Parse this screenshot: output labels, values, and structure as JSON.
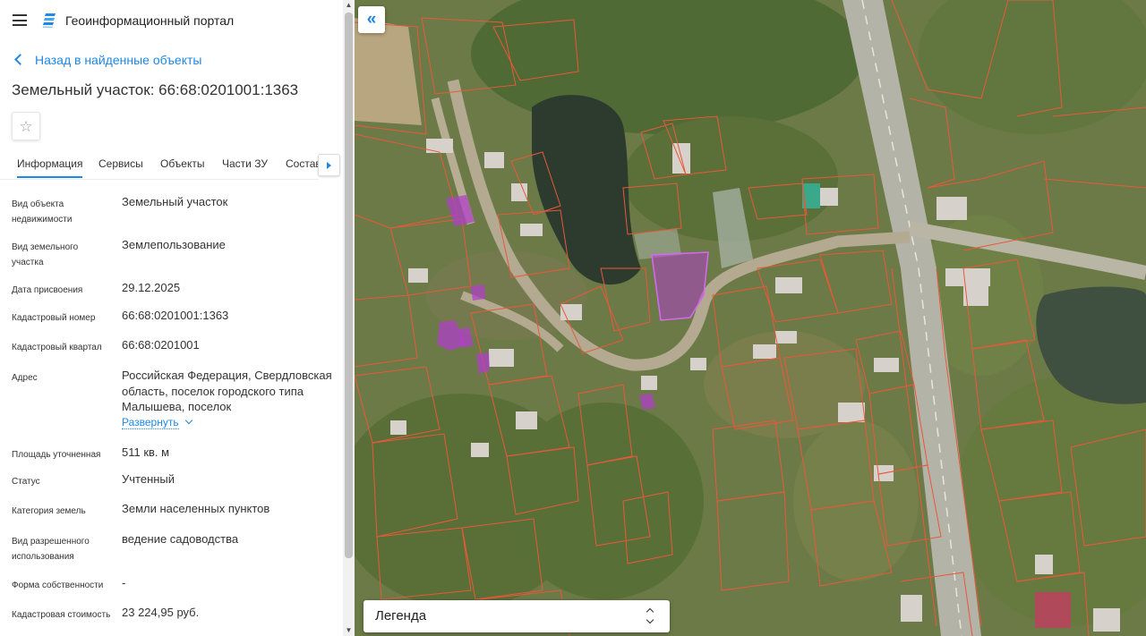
{
  "header": {
    "portal_title": "Геоинформационный портал"
  },
  "nav": {
    "back_label": "Назад в найденные объекты"
  },
  "object": {
    "title": "Земельный участок: 66:68:0201001:1363"
  },
  "tabs": [
    {
      "label": "Информация",
      "active": true
    },
    {
      "label": "Сервисы"
    },
    {
      "label": "Объекты"
    },
    {
      "label": "Части ЗУ"
    },
    {
      "label": "Состав"
    }
  ],
  "properties": [
    {
      "label": "Вид объекта недвижимости",
      "value": "Земельный участок"
    },
    {
      "label": "Вид земельного участка",
      "value": "Землепользование"
    },
    {
      "label": "Дата присвоения",
      "value": "29.12.2025"
    },
    {
      "label": "Кадастровый номер",
      "value": "66:68:0201001:1363"
    },
    {
      "label": "Кадастровый квартал",
      "value": "66:68:0201001"
    },
    {
      "label": "Адрес",
      "value": "Российская Федерация, Свердловская область, поселок городского типа Малышева, поселок",
      "expand_label": "Развернуть"
    },
    {
      "label": "Площадь уточненная",
      "value": "511 кв. м"
    },
    {
      "label": "Статус",
      "value": "Учтенный"
    },
    {
      "label": "Категория земель",
      "value": "Земли населенных пунктов"
    },
    {
      "label": "Вид разрешенного использования",
      "value": "ведение садоводства"
    },
    {
      "label": "Форма собственности",
      "value": "-"
    },
    {
      "label": "Кадастровая стоимость",
      "value": "23 224,95 руб."
    }
  ],
  "map": {
    "legend_label": "Легенда"
  },
  "colors": {
    "accent": "#1e88e5",
    "parcel_outline": "#e8593a",
    "selected_parcel": "#b040c8"
  },
  "icons": {
    "menu": "menu-icon",
    "logo": "portal-logo-icon",
    "favorite": "star-icon",
    "collapse": "double-chevron-left-icon"
  }
}
